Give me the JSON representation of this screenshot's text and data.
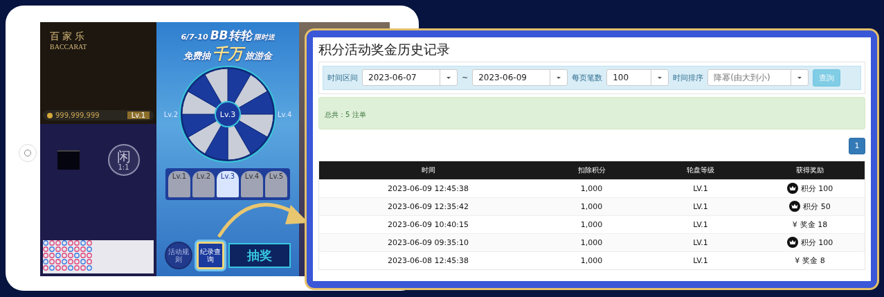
{
  "device": {
    "game": {
      "logo_cn": "百家乐",
      "logo_en": "BACCARAT",
      "balance": "999,999,999",
      "level": "Lv.1",
      "bet_label": "闲",
      "odds": "1:1"
    },
    "promo": {
      "title_top": [
        "6/7-10",
        "BB转轮",
        "限时送"
      ],
      "title_bottom": [
        "免费抽",
        "千万",
        "旅游金"
      ],
      "wheel_level": "Lv.3",
      "prev_level": "Lv.2",
      "next_level": "Lv.4",
      "tiers": [
        {
          "label": "Lv.1",
          "selected": false
        },
        {
          "label": "Lv.2",
          "selected": false
        },
        {
          "label": "Lv.3",
          "selected": true
        },
        {
          "label": "Lv.4",
          "selected": false
        },
        {
          "label": "Lv.5",
          "selected": false
        }
      ],
      "buttons": [
        {
          "label": "活动规则",
          "selected": false
        },
        {
          "label": "纪录查询",
          "selected": true
        }
      ],
      "draw_button": "抽奖"
    }
  },
  "panel": {
    "title": "积分活动奖金历史记录",
    "filters": {
      "range_label": "时间区间",
      "start_date": "2023-06-07",
      "range_separator": "~",
      "end_date": "2023-06-09",
      "page_size_label": "每页笔数",
      "page_size": "100",
      "sort_label": "时间排序",
      "sort": "降幂(由大到小)",
      "query_button": "查詢"
    },
    "summary": "总共：5 注单",
    "pages": [
      {
        "label": "1",
        "selected": true
      }
    ],
    "table": {
      "columns": [
        "时间",
        "扣除积分",
        "轮盘等级",
        "获得奖励"
      ],
      "rows": [
        {
          "time": "2023-06-09 12:45:38",
          "points": "1,000",
          "level": "LV.1",
          "reward": {
            "kind": "points",
            "text": "积分 100"
          }
        },
        {
          "time": "2023-06-09 12:35:42",
          "points": "1,000",
          "level": "LV.1",
          "reward": {
            "kind": "points",
            "text": "积分 50"
          }
        },
        {
          "time": "2023-06-09 10:40:15",
          "points": "1,000",
          "level": "LV.1",
          "reward": {
            "kind": "cash",
            "symbol": "¥",
            "text": "奖金 18"
          }
        },
        {
          "time": "2023-06-09 09:35:10",
          "points": "1,000",
          "level": "LV.1",
          "reward": {
            "kind": "points",
            "text": "积分 100"
          }
        },
        {
          "time": "2023-06-08 12:45:38",
          "points": "1,000",
          "level": "LV.1",
          "reward": {
            "kind": "cash",
            "symbol": "¥",
            "text": "奖金 8"
          }
        }
      ]
    }
  }
}
